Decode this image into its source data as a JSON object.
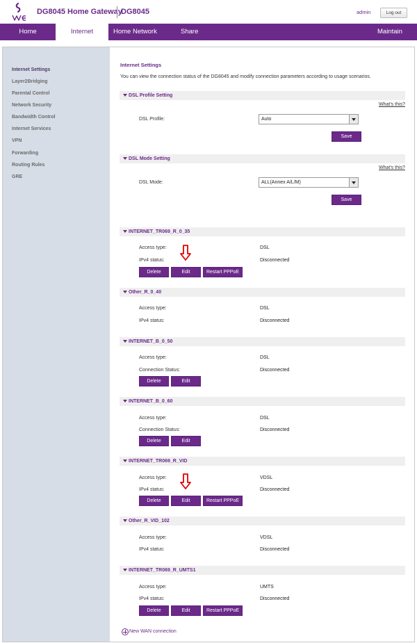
{
  "header": {
    "app_title": "DG8045 Home Gateway",
    "model": "DG8045",
    "user": "admin",
    "logout_label": "Log out",
    "logo_text": "WE"
  },
  "nav": {
    "items": [
      {
        "label": "Home"
      },
      {
        "label": "Internet",
        "active": true
      },
      {
        "label": "Home Network"
      },
      {
        "label": "Share"
      },
      {
        "label": "Maintain"
      }
    ]
  },
  "sidebar": {
    "items": [
      {
        "label": "Internet Settings",
        "active": true
      },
      {
        "label": "Layer2Bridging"
      },
      {
        "label": "Parental Control"
      },
      {
        "label": "Network Security"
      },
      {
        "label": "Bandwidth Control"
      },
      {
        "label": "Internet Services"
      },
      {
        "label": "VPN"
      },
      {
        "label": "Forwarding"
      },
      {
        "label": "Routing Rules"
      },
      {
        "label": "GRE"
      }
    ]
  },
  "page": {
    "title": "Internet Settings",
    "description": "You can view the connection status of the DG8045 and modify connection parameters according to usage scenarios."
  },
  "dsl_profile": {
    "title": "DSL Profile Setting",
    "whats_this": "What's this?",
    "label": "DSL Profile:",
    "value": "Auto",
    "save_label": "Save"
  },
  "dsl_mode": {
    "title": "DSL Mode Setting",
    "whats_this": "What's this?",
    "label": "DSL Mode:",
    "value": "ALL(Annex A/L/M)",
    "save_label": "Save"
  },
  "connections": [
    {
      "name": "INTERNET_TR069_R_0_35",
      "type_label": "Access type:",
      "type": "DSL",
      "status_label": "IPv4 status:",
      "status": "Disconnected",
      "buttons": [
        "Delete",
        "Edit",
        "Restart PPPoE"
      ]
    },
    {
      "name": "Other_R_0_40",
      "type_label": "Access type:",
      "type": "DSL",
      "status_label": "IPv4 status:",
      "status": "Disconnected",
      "buttons": []
    },
    {
      "name": "INTERNET_B_0_50",
      "type_label": "Access type:",
      "type": "DSL",
      "status_label": "Connection Status:",
      "status": "Disconnected",
      "buttons": [
        "Delete",
        "Edit"
      ]
    },
    {
      "name": "INTERNET_B_0_60",
      "type_label": "Access type:",
      "type": "DSL",
      "status_label": "Connection Status:",
      "status": "Disconnected",
      "buttons": [
        "Delete",
        "Edit"
      ]
    },
    {
      "name": "INTERNET_TR069_R_VID",
      "type_label": "Access type:",
      "type": "VDSL",
      "status_label": "IPv4 status:",
      "status": "Disconnected",
      "buttons": [
        "Delete",
        "Edit",
        "Restart PPPoE"
      ]
    },
    {
      "name": "Other_R_VID_102",
      "type_label": "Access type:",
      "type": "VDSL",
      "status_label": "IPv4 status:",
      "status": "Disconnected",
      "buttons": []
    },
    {
      "name": "INTERNET_TR069_R_UMTS1",
      "type_label": "Access type:",
      "type": "UMTS",
      "status_label": "IPv4 status:",
      "status": "Disconnected",
      "buttons": [
        "Delete",
        "Edit",
        "Restart PPPoE"
      ]
    }
  ],
  "add_wan_label": "New WAN connection",
  "colors": {
    "brand": "#6b2a8a",
    "sidebar_bg": "#d6dde6",
    "arrow": "#e00000"
  }
}
